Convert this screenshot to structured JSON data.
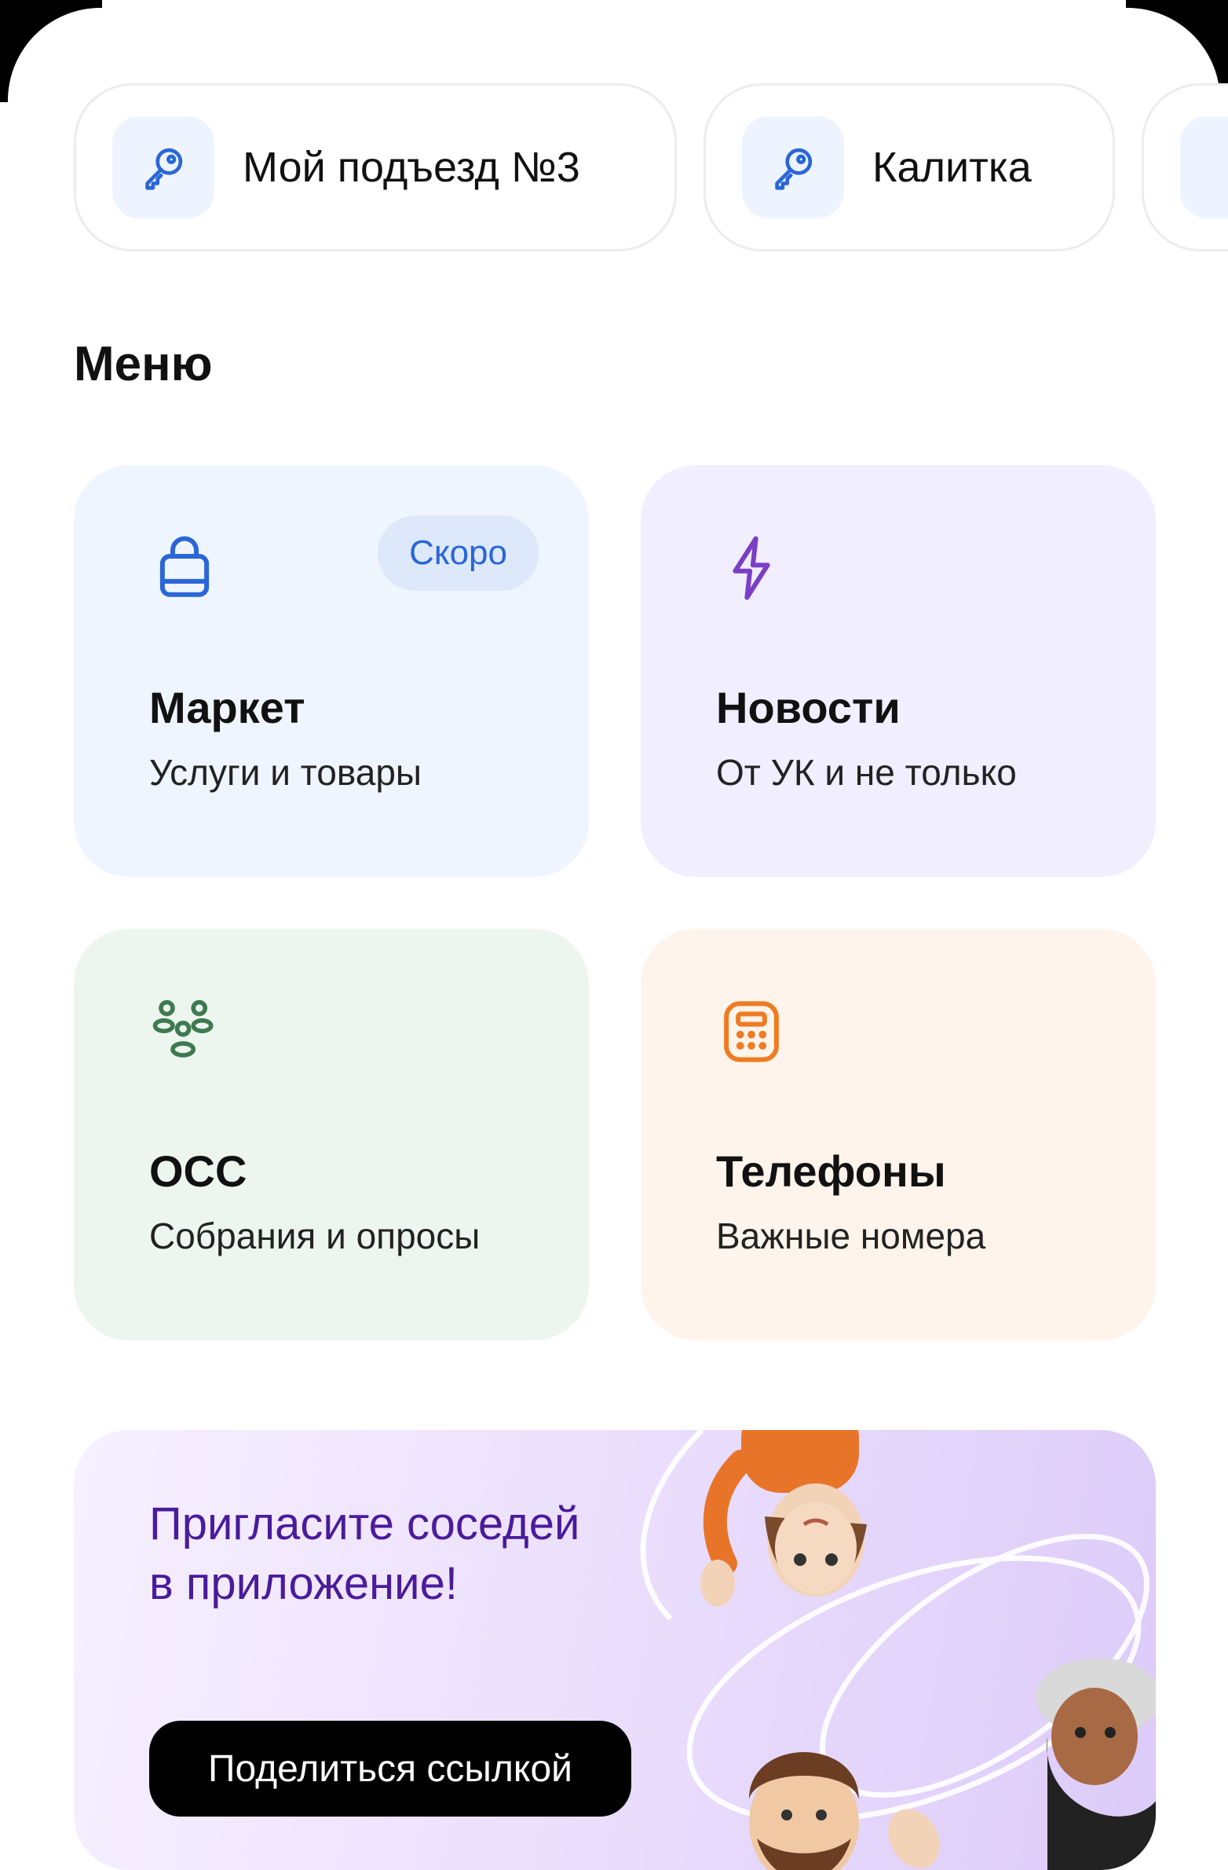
{
  "keys": [
    {
      "label": "Мой подъезд №3",
      "icon": "key-icon"
    },
    {
      "label": "Калитка",
      "icon": "key-icon"
    },
    {
      "label": "",
      "icon": "key-icon"
    }
  ],
  "menu": {
    "title": "Меню",
    "cards": [
      {
        "title": "Маркет",
        "subtitle": "Услуги и товары",
        "badge": "Скоро",
        "icon": "shopping-bag-icon",
        "bg": "#eff5ff",
        "icon_color": "#2a66d6"
      },
      {
        "title": "Новости",
        "subtitle": "От УК и не только",
        "icon": "lightning-icon",
        "bg": "#f0eeff",
        "icon_color": "#7a3fc4"
      },
      {
        "title": "ОСС",
        "subtitle": "Собрания и опросы",
        "icon": "people-group-icon",
        "bg": "#ecf6ef",
        "icon_color": "#3d7a4f"
      },
      {
        "title": "Телефоны",
        "subtitle": "Важные номера",
        "icon": "phone-keypad-icon",
        "bg": "#fff4eb",
        "icon_color": "#ef7b22"
      }
    ]
  },
  "invite": {
    "text": "Пригласите соседей в приложение!",
    "button_label": "Поделиться ссылкой",
    "text_color": "#4a1b9a"
  }
}
